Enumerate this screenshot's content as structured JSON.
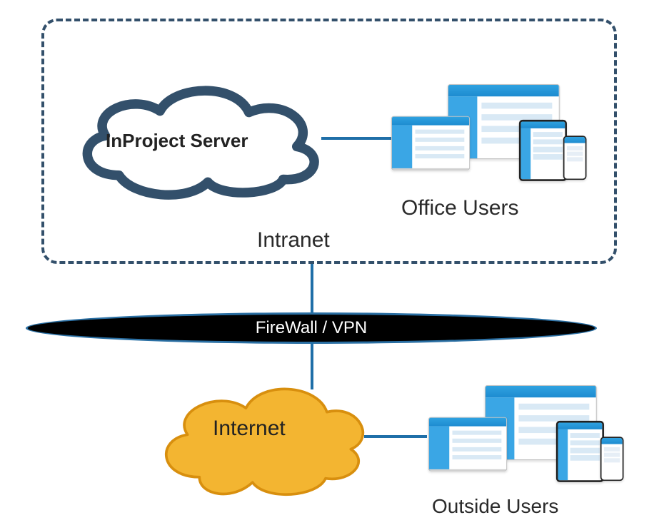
{
  "intranet": {
    "label": "Intranet",
    "server_cloud_label": "InProject Server",
    "office_users_label": "Office Users"
  },
  "firewall": {
    "label": "FireWall / VPN"
  },
  "internet": {
    "cloud_label": "Internet",
    "outside_users_label": "Outside Users"
  },
  "colors": {
    "cloud_stroke": "#33506b",
    "internet_cloud_fill": "#f3b531",
    "internet_cloud_stroke": "#d88f0e",
    "connector": "#1f6fa8",
    "firewall_bg": "#000000",
    "firewall_border": "#2a6fa3"
  }
}
